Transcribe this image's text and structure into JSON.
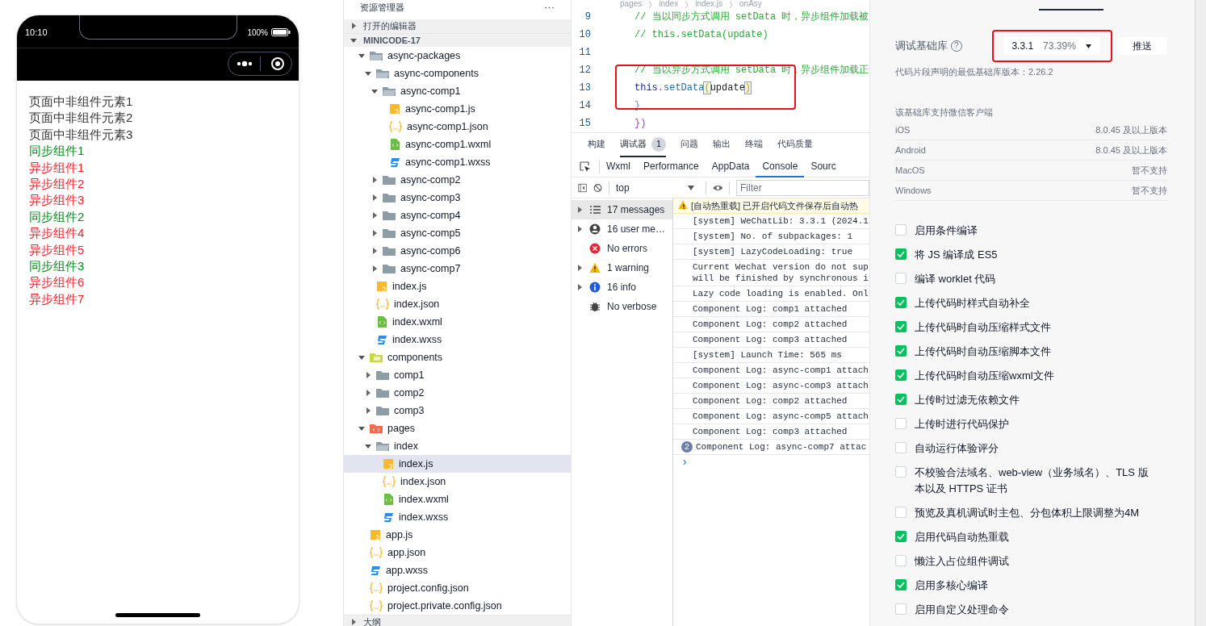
{
  "simulator": {
    "time": "10:10",
    "battery": "100%",
    "lines": [
      {
        "text": "页面中非组件元素1",
        "kind": "plain"
      },
      {
        "text": "页面中非组件元素2",
        "kind": "plain"
      },
      {
        "text": "页面中非组件元素3",
        "kind": "plain"
      },
      {
        "text": "同步组件1",
        "kind": "sync"
      },
      {
        "text": "异步组件1",
        "kind": "async"
      },
      {
        "text": "异步组件2",
        "kind": "async"
      },
      {
        "text": "异步组件3",
        "kind": "async"
      },
      {
        "text": "同步组件2",
        "kind": "sync"
      },
      {
        "text": "异步组件4",
        "kind": "async"
      },
      {
        "text": "异步组件5",
        "kind": "async"
      },
      {
        "text": "同步组件3",
        "kind": "sync"
      },
      {
        "text": "异步组件6",
        "kind": "async"
      },
      {
        "text": "异步组件7",
        "kind": "async"
      }
    ]
  },
  "explorer": {
    "title": "资源管理器",
    "more": "···",
    "open_editors": {
      "label": "打开的编辑器",
      "expanded": false
    },
    "project": {
      "label": "MINICODE-17",
      "expanded": true
    },
    "tree": [
      {
        "label": "async-packages",
        "kind": "folder",
        "expanded": true,
        "selected": false,
        "children": [
          {
            "label": "async-components",
            "kind": "folder",
            "expanded": true,
            "selected": false,
            "children": [
              {
                "label": "async-comp1",
                "kind": "folder",
                "expanded": true,
                "selected": false,
                "children": [
                  {
                    "label": "async-comp1.js",
                    "kind": "js",
                    "selected": false
                  },
                  {
                    "label": "async-comp1.json",
                    "kind": "json",
                    "selected": false
                  },
                  {
                    "label": "async-comp1.wxml",
                    "kind": "wxml",
                    "selected": false
                  },
                  {
                    "label": "async-comp1.wxss",
                    "kind": "wxss",
                    "selected": false
                  }
                ]
              },
              {
                "label": "async-comp2",
                "kind": "folder",
                "expanded": false,
                "selected": false
              },
              {
                "label": "async-comp3",
                "kind": "folder",
                "expanded": false,
                "selected": false
              },
              {
                "label": "async-comp4",
                "kind": "folder",
                "expanded": false,
                "selected": false
              },
              {
                "label": "async-comp5",
                "kind": "folder",
                "expanded": false,
                "selected": false
              },
              {
                "label": "async-comp6",
                "kind": "folder",
                "expanded": false,
                "selected": false
              },
              {
                "label": "async-comp7",
                "kind": "folder",
                "expanded": false,
                "selected": false
              }
            ]
          },
          {
            "label": "index.js",
            "kind": "js",
            "selected": false
          },
          {
            "label": "index.json",
            "kind": "json",
            "selected": false
          },
          {
            "label": "index.wxml",
            "kind": "wxml",
            "selected": false
          },
          {
            "label": "index.wxss",
            "kind": "wxss",
            "selected": false
          }
        ]
      },
      {
        "label": "components",
        "kind": "components",
        "expanded": true,
        "selected": false,
        "children": [
          {
            "label": "comp1",
            "kind": "folder",
            "expanded": false,
            "selected": false
          },
          {
            "label": "comp2",
            "kind": "folder",
            "expanded": false,
            "selected": false
          },
          {
            "label": "comp3",
            "kind": "folder",
            "expanded": false,
            "selected": false
          }
        ]
      },
      {
        "label": "pages",
        "kind": "pages",
        "expanded": true,
        "selected": false,
        "children": [
          {
            "label": "index",
            "kind": "folder",
            "expanded": true,
            "selected": false,
            "children": [
              {
                "label": "index.js",
                "kind": "js",
                "selected": true
              },
              {
                "label": "index.json",
                "kind": "json",
                "selected": false
              },
              {
                "label": "index.wxml",
                "kind": "wxml",
                "selected": false
              },
              {
                "label": "index.wxss",
                "kind": "wxss",
                "selected": false
              }
            ]
          }
        ]
      },
      {
        "label": "app.js",
        "kind": "js",
        "selected": false
      },
      {
        "label": "app.json",
        "kind": "json",
        "selected": false
      },
      {
        "label": "app.wxss",
        "kind": "wxss",
        "selected": false
      },
      {
        "label": "project.config.json",
        "kind": "json",
        "selected": false
      },
      {
        "label": "project.private.config.json",
        "kind": "json",
        "selected": false
      }
    ],
    "outline": {
      "label": "大纲",
      "expanded": false
    }
  },
  "editor": {
    "breadcrumb": [
      "pages",
      "index",
      "index.js",
      "onAsy"
    ],
    "lines": [
      {
        "number": "9",
        "tokens": [
          {
            "text": "// 当以同步方式调用 setData 时，异步组件加载被",
            "kind": "comment"
          }
        ]
      },
      {
        "number": "10",
        "tokens": [
          {
            "text": "// this.setData(update)",
            "kind": "comment"
          }
        ]
      },
      {
        "number": "11"
      },
      {
        "number": "12",
        "tokens": [
          {
            "text": "// 当以异步方式调用 setData 时，异步组件加载正",
            "kind": "comment"
          }
        ]
      },
      {
        "number": "13",
        "tokens": [
          {
            "text": "this",
            "kind": "keyword"
          },
          {
            "text": ".",
            "kind": "punct"
          },
          {
            "text": "setData",
            "kind": "method"
          },
          {
            "text": "(",
            "kind": "bracket"
          },
          {
            "text": "update",
            "kind": "plain"
          },
          {
            "text": ")",
            "kind": "bracket"
          }
        ]
      },
      {
        "number": "14",
        "tokens": [
          {
            "text": "}",
            "kind": "brace"
          }
        ]
      },
      {
        "number": "15",
        "tokens": [
          {
            "text": "})",
            "kind": "punct"
          }
        ]
      }
    ]
  },
  "panel_tabs": [
    {
      "label": "构建",
      "selected": false
    },
    {
      "label": "调试器",
      "selected": true,
      "badge": "1"
    },
    {
      "label": "问题",
      "selected": false
    },
    {
      "label": "输出",
      "selected": false
    },
    {
      "label": "终端",
      "selected": false
    },
    {
      "label": "代码质量",
      "selected": false
    }
  ],
  "devtools_tabs": [
    {
      "label": "Wxml",
      "selected": false
    },
    {
      "label": "Performance",
      "selected": false
    },
    {
      "label": "AppData",
      "selected": false
    },
    {
      "label": "Console",
      "selected": true
    },
    {
      "label": "Sourc",
      "selected": false
    }
  ],
  "console": {
    "context": "top",
    "filter_placeholder": "Filter",
    "sidebar": [
      {
        "label": "17 messages",
        "kind": "list",
        "expandable": true,
        "selected": true
      },
      {
        "label": "16 user me…",
        "kind": "user",
        "expandable": true,
        "selected": false
      },
      {
        "label": "No errors",
        "kind": "error",
        "expandable": false,
        "selected": false
      },
      {
        "label": "1 warning",
        "kind": "warning",
        "expandable": true,
        "selected": false
      },
      {
        "label": "16 info",
        "kind": "info",
        "expandable": true,
        "selected": false
      },
      {
        "label": "No verbose",
        "kind": "verbose",
        "expandable": false,
        "selected": false
      }
    ],
    "messages": [
      {
        "text": "[自动热重载] 已开启代码文件保存后自动热",
        "kind": "warning"
      },
      {
        "text": "[system] WeChatLib: 3.3.1 (2024.1",
        "kind": "log"
      },
      {
        "text": "[system] No. of subpackages: 1",
        "kind": "log"
      },
      {
        "text": "[system] LazyCodeLoading: true",
        "kind": "log"
      },
      {
        "text": "Current Wechat version do not sup\nwill be finished by synchronous i",
        "kind": "log"
      },
      {
        "text": "Lazy code loading is enabled. Onl",
        "kind": "log"
      },
      {
        "text": "Component Log: comp1 attached",
        "kind": "log"
      },
      {
        "text": "Component Log: comp2 attached",
        "kind": "log"
      },
      {
        "text": "Component Log: comp3 attached",
        "kind": "log"
      },
      {
        "text": "[system] Launch Time: 565 ms",
        "kind": "log"
      },
      {
        "text": "Component Log: async-comp1 attach",
        "kind": "log"
      },
      {
        "text": "Component Log: async-comp3 attach",
        "kind": "log"
      },
      {
        "text": "Component Log: comp2 attached",
        "kind": "log"
      },
      {
        "text": "Component Log: async-comp5 attach",
        "kind": "log"
      },
      {
        "text": "Component Log: comp3 attached",
        "kind": "log"
      },
      {
        "text": "Component Log: async-comp7 attac",
        "kind": "log",
        "count": "2"
      }
    ],
    "prompt": "›"
  },
  "settings": {
    "library_label": "调试基础库",
    "help": "?",
    "version": "3.3.1",
    "share": "73.39%",
    "push_button": "推送",
    "note": "代码片段声明的最低基础库版本：2.26.2",
    "support_title": "该基础库支持微信客户端",
    "support": [
      {
        "platform": "iOS",
        "value": "8.0.45 及以上版本"
      },
      {
        "platform": "Android",
        "value": "8.0.45 及以上版本"
      },
      {
        "platform": "MacOS",
        "value": "暂不支持"
      },
      {
        "platform": "Windows",
        "value": "暂不支持"
      }
    ],
    "options": [
      {
        "label": "启用条件编译",
        "checked": false
      },
      {
        "label": "将 JS 编译成 ES5",
        "checked": true
      },
      {
        "label": "编译 worklet 代码",
        "checked": false
      },
      {
        "label": "上传代码时样式自动补全",
        "checked": true
      },
      {
        "label": "上传代码时自动压缩样式文件",
        "checked": true
      },
      {
        "label": "上传代码时自动压缩脚本文件",
        "checked": true
      },
      {
        "label": "上传代码时自动压缩wxml文件",
        "checked": true
      },
      {
        "label": "上传时过滤无依赖文件",
        "checked": true
      },
      {
        "label": "上传时进行代码保护",
        "checked": false
      },
      {
        "label": "自动运行体验评分",
        "checked": false
      },
      {
        "label": "不校验合法域名、web-view（业务域名）、TLS 版本以及 HTTPS 证书",
        "checked": false
      },
      {
        "label": "预览及真机调试时主包、分包体积上限调整为4M",
        "checked": false
      },
      {
        "label": "启用代码自动热重载",
        "checked": true
      },
      {
        "label": "懒注入占位组件调试",
        "checked": false
      },
      {
        "label": "启用多核心编译",
        "checked": true
      },
      {
        "label": "启用自定义处理命令",
        "checked": false
      }
    ]
  }
}
